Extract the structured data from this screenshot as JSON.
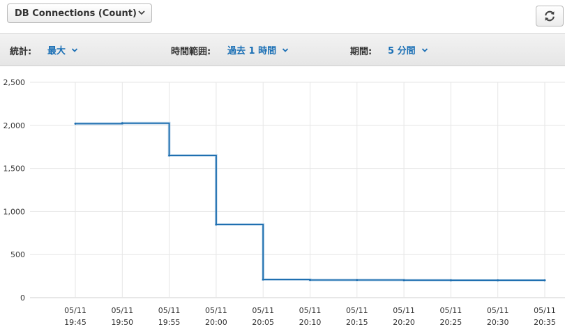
{
  "header": {
    "metric_label": "DB Connections (Count)",
    "refresh_icon": "refresh-icon"
  },
  "toolbar": {
    "stat_label": "統計:",
    "stat_value": "最大",
    "range_label": "時間範囲:",
    "range_value": "過去 1 時間",
    "period_label": "期間:",
    "period_value": "5 分間"
  },
  "colors": {
    "line": "#1f6fb0",
    "accent": "#1a6fb5",
    "grid": "#e6e6e6"
  },
  "chart_data": {
    "type": "line",
    "step": true,
    "x": [
      "05/11 19:45",
      "05/11 19:50",
      "05/11 19:55",
      "05/11 20:00",
      "05/11 20:05",
      "05/11 20:10",
      "05/11 20:15",
      "05/11 20:20",
      "05/11 20:25",
      "05/11 20:30",
      "05/11 20:35"
    ],
    "x_tick_dates": [
      "05/11",
      "05/11",
      "05/11",
      "05/11",
      "05/11",
      "05/11",
      "05/11",
      "05/11",
      "05/11",
      "05/11",
      "05/11"
    ],
    "x_tick_times": [
      "19:45",
      "19:50",
      "19:55",
      "20:00",
      "20:05",
      "20:10",
      "20:15",
      "20:20",
      "20:25",
      "20:30",
      "20:35"
    ],
    "series": [
      {
        "values": [
          2020,
          2025,
          1650,
          850,
          210,
          205,
          205,
          203,
          202,
          202,
          202
        ]
      }
    ],
    "y_ticks": [
      0,
      500,
      1000,
      1500,
      2000,
      2500
    ],
    "y_tick_labels": [
      "0",
      "500",
      "1,000",
      "1,500",
      "2,000",
      "2,500"
    ],
    "ylim": [
      0,
      2500
    ],
    "grid": true,
    "title": "",
    "xlabel": "",
    "ylabel": ""
  }
}
